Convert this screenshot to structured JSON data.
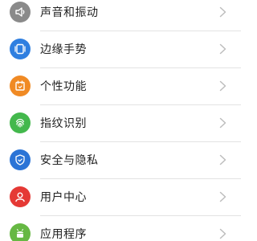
{
  "settings": {
    "items": [
      {
        "label": "声音和振动",
        "icon": "speaker-icon",
        "color": "#8a8a8a"
      },
      {
        "label": "边缘手势",
        "icon": "edge-gesture-icon",
        "color": "#2f7fe0"
      },
      {
        "label": "个性功能",
        "icon": "calendar-icon",
        "color": "#f08a24"
      },
      {
        "label": "指纹识别",
        "icon": "fingerprint-icon",
        "color": "#43b84c"
      },
      {
        "label": "安全与隐私",
        "icon": "shield-icon",
        "color": "#2b74d6"
      },
      {
        "label": "用户中心",
        "icon": "user-icon",
        "color": "#e53935"
      },
      {
        "label": "应用程序",
        "icon": "android-icon",
        "color": "#66b843"
      }
    ]
  }
}
